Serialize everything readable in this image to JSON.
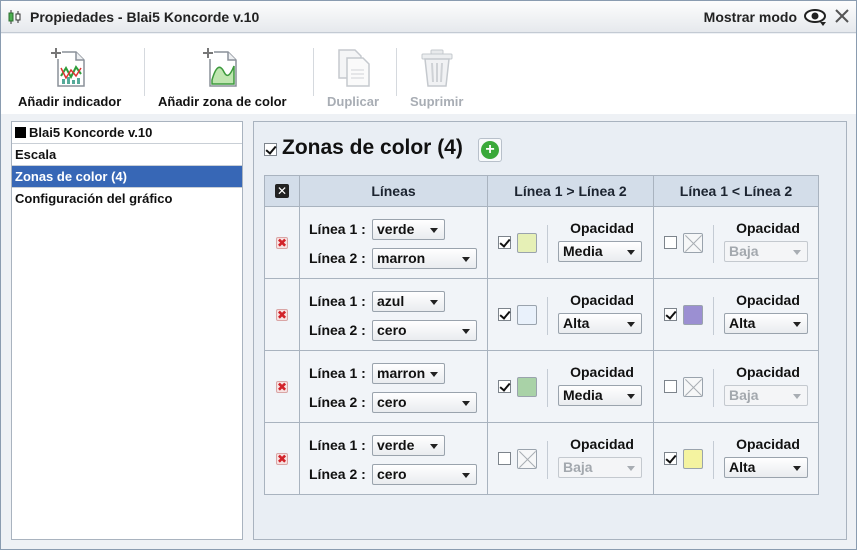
{
  "window": {
    "title": "Propiedades - Blai5 Koncorde v.10",
    "mode_label": "Mostrar modo"
  },
  "toolbar": {
    "add_indicator": "Añadir indicador",
    "add_color_zone": "Añadir zona de color",
    "duplicate": "Duplicar",
    "delete": "Suprimir"
  },
  "sidebar": {
    "items": [
      {
        "label": "Blai5 Koncorde v.10"
      },
      {
        "label": "Escala"
      },
      {
        "label": "Zonas de color (4)"
      },
      {
        "label": "Configuración del gráfico"
      }
    ]
  },
  "zones": {
    "title": "Zonas de color (4)",
    "enabled": true,
    "headers": {
      "lines": "Líneas",
      "gt": "Línea 1 > Línea 2",
      "lt": "Línea 1 < Línea 2"
    },
    "line1_label": "Línea 1 :",
    "line2_label": "Línea 2 :",
    "opacity_label": "Opacidad",
    "rows": [
      {
        "line1": "verde",
        "line2": "marron",
        "gt": {
          "checked": true,
          "color": "#e6f0b6",
          "opacity": "Media"
        },
        "lt": {
          "checked": false,
          "color": null,
          "opacity": "Baja"
        }
      },
      {
        "line1": "azul",
        "line2": "cero",
        "gt": {
          "checked": true,
          "color": "#e9f1fb",
          "opacity": "Alta"
        },
        "lt": {
          "checked": true,
          "color": "#9b8fd2",
          "opacity": "Alta"
        }
      },
      {
        "line1": "marron",
        "line2": "cero",
        "gt": {
          "checked": true,
          "color": "#a9d2a7",
          "opacity": "Media"
        },
        "lt": {
          "checked": false,
          "color": null,
          "opacity": "Baja"
        }
      },
      {
        "line1": "verde",
        "line2": "cero",
        "gt": {
          "checked": false,
          "color": null,
          "opacity": "Baja"
        },
        "lt": {
          "checked": true,
          "color": "#f4f3a0",
          "opacity": "Alta"
        }
      }
    ]
  }
}
